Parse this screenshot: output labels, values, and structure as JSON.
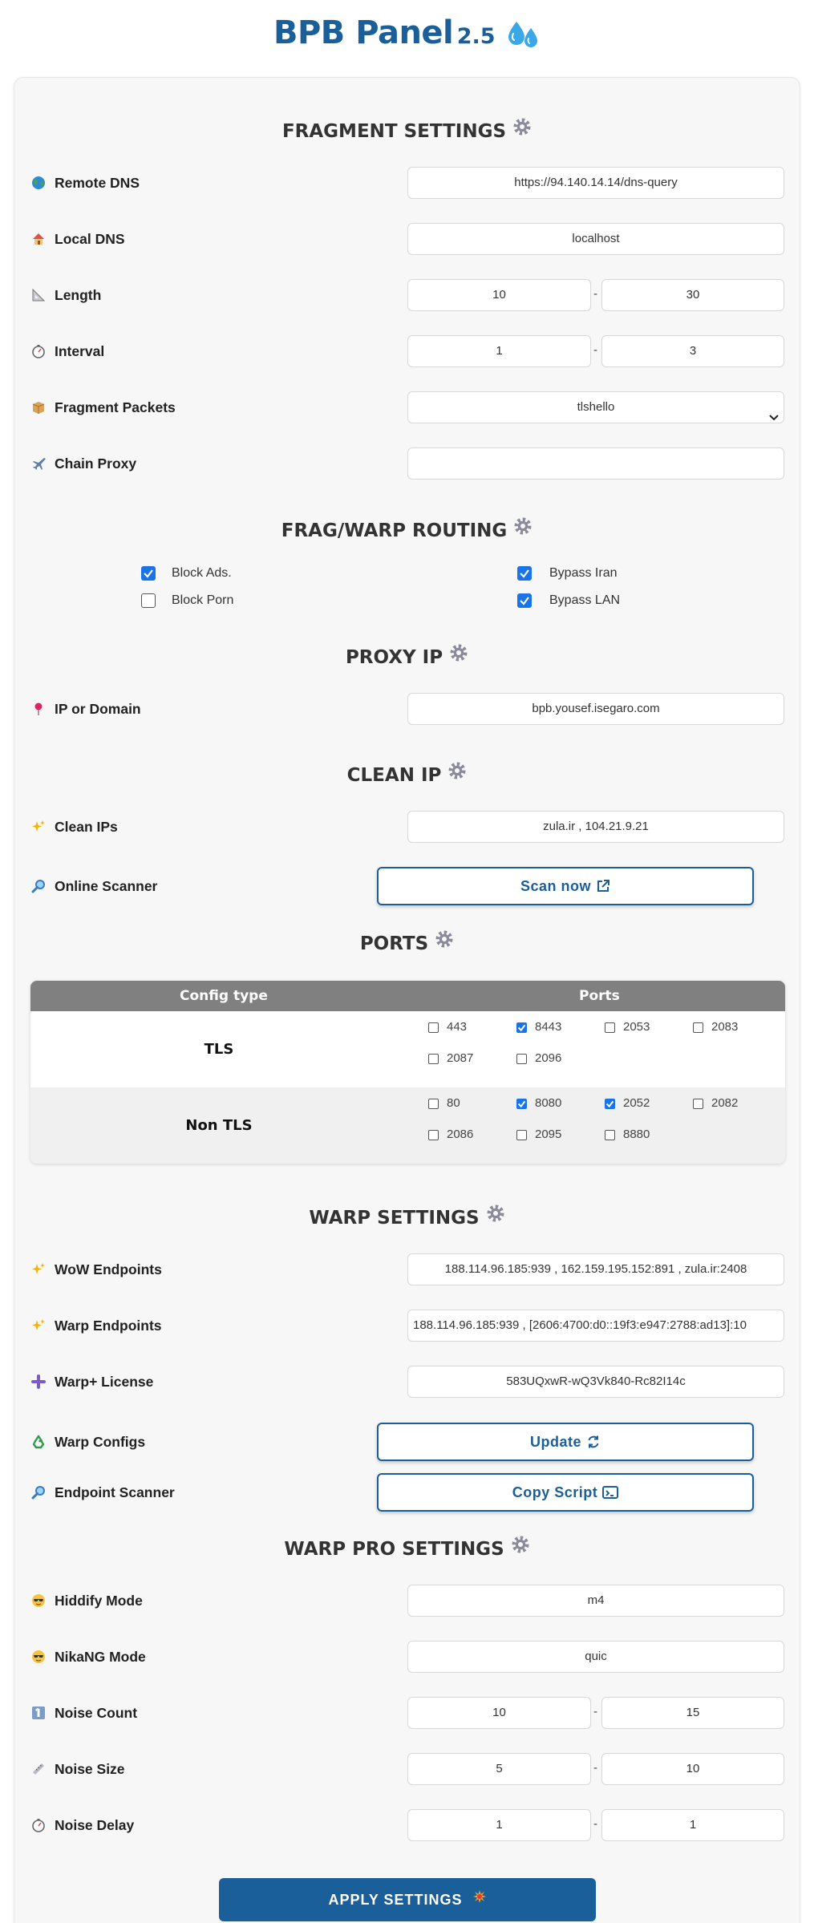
{
  "header": {
    "title": "BPB Panel",
    "version": "2.5"
  },
  "sections": {
    "fragment": "FRAGMENT SETTINGS",
    "routing": "FRAG/WARP ROUTING",
    "proxy_ip": "PROXY IP",
    "clean_ip": "CLEAN IP",
    "ports": "PORTS",
    "warp": "WARP SETTINGS",
    "warp_pro": "WARP PRO SETTINGS"
  },
  "fragment": {
    "remote_dns": {
      "label": "Remote DNS",
      "value": "https://94.140.14.14/dns-query"
    },
    "local_dns": {
      "label": "Local DNS",
      "value": "localhost"
    },
    "length": {
      "label": "Length",
      "min": "10",
      "max": "30"
    },
    "interval": {
      "label": "Interval",
      "min": "1",
      "max": "3"
    },
    "packets": {
      "label": "Fragment Packets",
      "value": "tlshello"
    },
    "chain_proxy": {
      "label": "Chain Proxy",
      "value": ""
    }
  },
  "routing": {
    "block_ads": {
      "label": "Block Ads.",
      "checked": true
    },
    "bypass_iran": {
      "label": "Bypass Iran",
      "checked": true
    },
    "block_porn": {
      "label": "Block Porn",
      "checked": false
    },
    "bypass_lan": {
      "label": "Bypass LAN",
      "checked": true
    }
  },
  "proxy_ip": {
    "label": "IP or Domain",
    "value": "bpb.yousef.isegaro.com"
  },
  "clean_ip": {
    "clean_ips": {
      "label": "Clean IPs",
      "value": "zula.ir , 104.21.9.21"
    },
    "scanner": {
      "label": "Online Scanner",
      "button": "Scan now"
    }
  },
  "ports": {
    "headers": {
      "config_type": "Config type",
      "ports": "Ports"
    },
    "tls": {
      "label": "TLS",
      "items": [
        {
          "port": "443",
          "checked": false
        },
        {
          "port": "8443",
          "checked": true
        },
        {
          "port": "2053",
          "checked": false
        },
        {
          "port": "2083",
          "checked": false
        },
        {
          "port": "2087",
          "checked": false
        },
        {
          "port": "2096",
          "checked": false
        }
      ]
    },
    "non_tls": {
      "label": "Non TLS",
      "items": [
        {
          "port": "80",
          "checked": false
        },
        {
          "port": "8080",
          "checked": true
        },
        {
          "port": "2052",
          "checked": true
        },
        {
          "port": "2082",
          "checked": false
        },
        {
          "port": "2086",
          "checked": false
        },
        {
          "port": "2095",
          "checked": false
        },
        {
          "port": "8880",
          "checked": false
        }
      ]
    }
  },
  "warp": {
    "wow_endpoints": {
      "label": "WoW Endpoints",
      "value": "188.114.96.185:939 , 162.159.195.152:891 , zula.ir:2408"
    },
    "warp_endpoints": {
      "label": "Warp Endpoints",
      "value": "188.114.96.185:939 , [2606:4700:d0::19f3:e947:2788:ad13]:10"
    },
    "license": {
      "label": "Warp+ License",
      "value": "583UQxwR-wQ3Vk840-Rc82I14c"
    },
    "configs": {
      "label": "Warp Configs",
      "button": "Update"
    },
    "scanner": {
      "label": "Endpoint Scanner",
      "button": "Copy Script"
    }
  },
  "warp_pro": {
    "hiddify": {
      "label": "Hiddify Mode",
      "value": "m4"
    },
    "nikang": {
      "label": "NikaNG Mode",
      "value": "quic"
    },
    "noise_count": {
      "label": "Noise Count",
      "min": "10",
      "max": "15"
    },
    "noise_size": {
      "label": "Noise Size",
      "min": "5",
      "max": "10"
    },
    "noise_delay": {
      "label": "Noise Delay",
      "min": "1",
      "max": "1"
    }
  },
  "apply_button": "APPLY SETTINGS",
  "colors": {
    "brand": "#1a5f99",
    "checkbox": "#1a73e8",
    "table_header": "#808080"
  }
}
